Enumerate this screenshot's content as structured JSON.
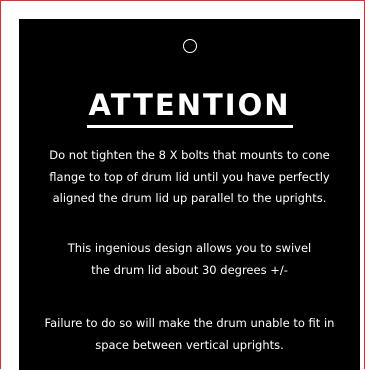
{
  "heading": "ATTENTION",
  "paragraphs": [
    {
      "lines": [
        "Do not tighten the 8 X bolts that mounts to cone",
        "flange to top of drum lid until you have perfectly",
        "aligned the drum lid up parallel to the uprights."
      ]
    },
    {
      "lines": [
        "This ingenious design allows you to swivel",
        "the drum lid about 30 degrees +/-"
      ]
    },
    {
      "lines": [
        "Failure to do so will make the drum unable to fit in",
        "space between vertical uprights."
      ]
    }
  ],
  "colors": {
    "tag_background": "#000000",
    "text": "#ffffff",
    "frame_border": "#c23a3a"
  },
  "icons": {
    "hole": "circle-hole-icon"
  }
}
